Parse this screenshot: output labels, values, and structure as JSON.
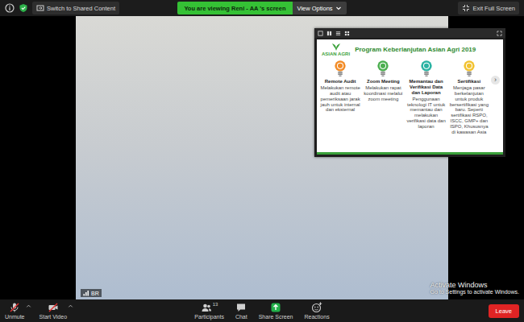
{
  "top_bar": {
    "switch_button": "Switch to Shared Content",
    "viewing_banner": "You are viewing Reni - AA 's screen",
    "view_options": "View Options",
    "exit_button": "Exit Full Screen"
  },
  "video": {
    "participant_label": "BR"
  },
  "shared_window": {
    "slide": {
      "logo": "ASIAN AGRI",
      "title": "Program Keberlanjutan Asian Agri 2019",
      "next": "›",
      "items": [
        {
          "label": "Remote Audit",
          "description": "Melakukan remote audit atau pemeriksaan jarak jauh untuk internal dan eksternal",
          "color": "#f28c28"
        },
        {
          "label": "Zoom Meeting",
          "description": "Melakukan rapat koordinasi melalui zoom meeting",
          "color": "#4caf50"
        },
        {
          "label": "Memantau dan Verifikasi Data dan Laporan",
          "description": "Penggunaan teknologi IT untuk memantau dan melakukan verifikasi data dan laporan",
          "color": "#2bb3a3"
        },
        {
          "label": "Sertifikasi",
          "description": "Menjaga pasar berkelanjutan untuk produk bersertifikasi yang baru. Seperti sertifikasi RSPO, ISCC, GMP+ dan ISPO, Khususnya di kawasan Asia",
          "color": "#f2c230"
        }
      ]
    }
  },
  "watermark": {
    "title": "Activate Windows",
    "subtitle": "Go to Settings to activate Windows."
  },
  "toolbar": {
    "controls_left": [
      {
        "label": "Unmute",
        "kind": "mic",
        "muted": true
      },
      {
        "label": "Start Video",
        "kind": "video",
        "muted": true
      }
    ],
    "controls_center": [
      {
        "label": "Participants",
        "kind": "participants",
        "count": "13"
      },
      {
        "label": "Chat",
        "kind": "chat"
      },
      {
        "label": "Share Screen",
        "kind": "share"
      },
      {
        "label": "Reactions",
        "kind": "reactions"
      }
    ],
    "leave": "Leave"
  }
}
